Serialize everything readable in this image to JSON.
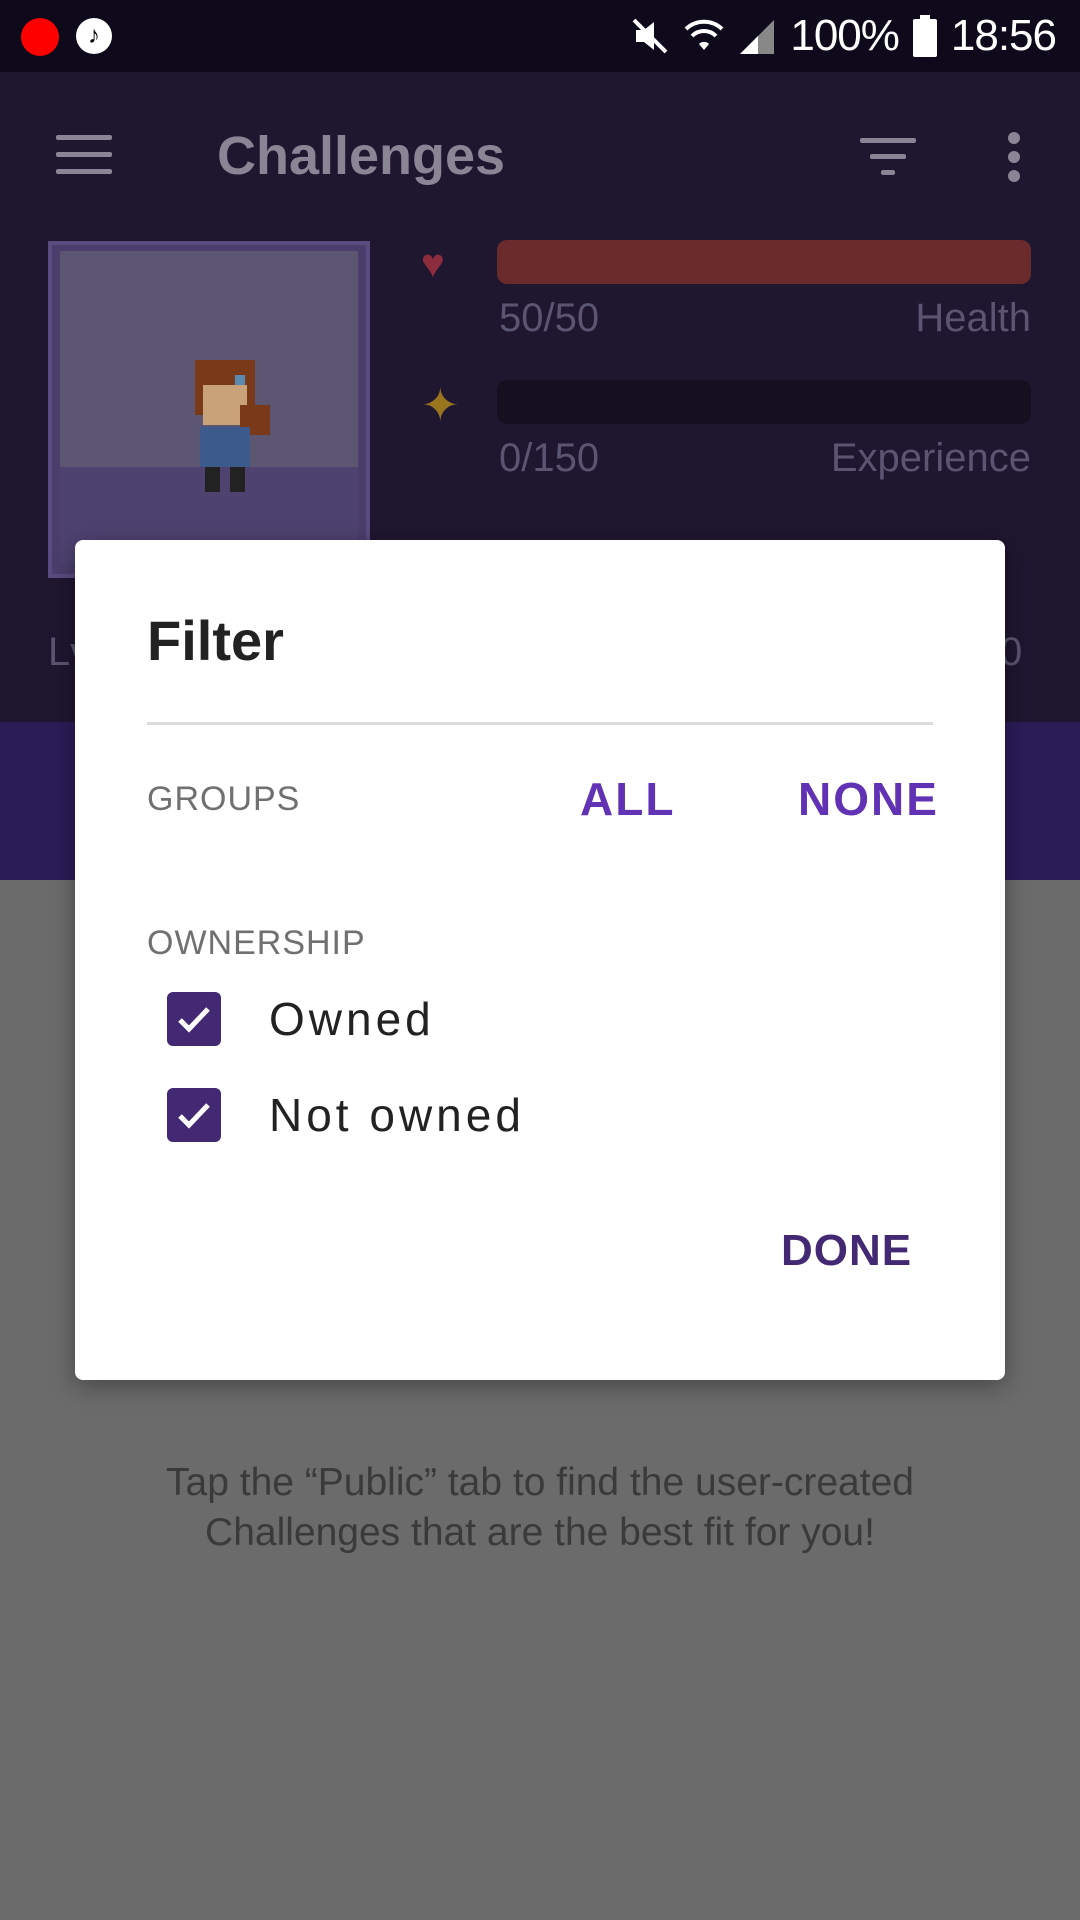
{
  "status_bar": {
    "battery": "100%",
    "time": "18:56",
    "icons": [
      "record-icon",
      "music-icon",
      "mute-icon",
      "wifi-icon",
      "signal-icon",
      "battery-icon"
    ]
  },
  "toolbar": {
    "title": "Challenges",
    "icons": [
      "menu-icon",
      "filter-icon",
      "more-icon"
    ]
  },
  "stats": {
    "health_value": "50/50",
    "health_label": "Health",
    "health_fraction": 1.0,
    "experience_value": "0/150",
    "experience_label": "Experience",
    "experience_fraction": 0.0,
    "level_partial": "Lv",
    "gold_partial": "0"
  },
  "background": {
    "empty_text": "Tap the “Public” tab to find the user-created Challenges that are the best fit for you!"
  },
  "dialog": {
    "title": "Filter",
    "groups_label": "GROUPS",
    "all_label": "ALL",
    "none_label": "NONE",
    "ownership_label": "OWNERSHIP",
    "options": [
      {
        "label": "Owned",
        "checked": true
      },
      {
        "label": "Not owned",
        "checked": true
      }
    ],
    "done_label": "DONE"
  },
  "colors": {
    "accent": "#6133b4",
    "checkbox": "#432874",
    "health": "#6b2a2c"
  }
}
